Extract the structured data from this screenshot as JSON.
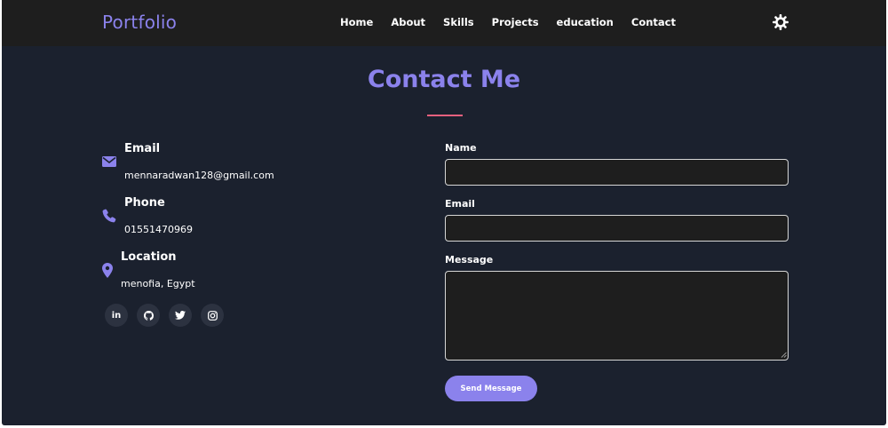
{
  "nav": {
    "brand": "Portfolio",
    "links": [
      "Home",
      "About",
      "Skills",
      "Projects",
      "education",
      "Contact"
    ],
    "theme_icon": "sun-icon"
  },
  "section": {
    "title": "Contact Me"
  },
  "contact_info": [
    {
      "icon": "envelope-icon",
      "title": "Email",
      "value": "mennaradwan128@gmail.com"
    },
    {
      "icon": "phone-icon",
      "title": "Phone",
      "value": "01551470969"
    },
    {
      "icon": "location-pin-icon",
      "title": "Location",
      "value": "menofia, Egypt"
    }
  ],
  "socials": [
    {
      "icon": "linkedin-icon",
      "glyph": "in"
    },
    {
      "icon": "github-icon"
    },
    {
      "icon": "twitter-icon"
    },
    {
      "icon": "instagram-icon"
    }
  ],
  "form": {
    "name_label": "Name",
    "name_value": "",
    "email_label": "Email",
    "email_value": "",
    "message_label": "Message",
    "message_value": "",
    "submit_label": "Send Message"
  },
  "colors": {
    "accent": "#8b82ec",
    "underline": "#e8607e",
    "background": "#1b212e",
    "navbar": "#1e1e1e",
    "social_bg": "#2c3240"
  }
}
